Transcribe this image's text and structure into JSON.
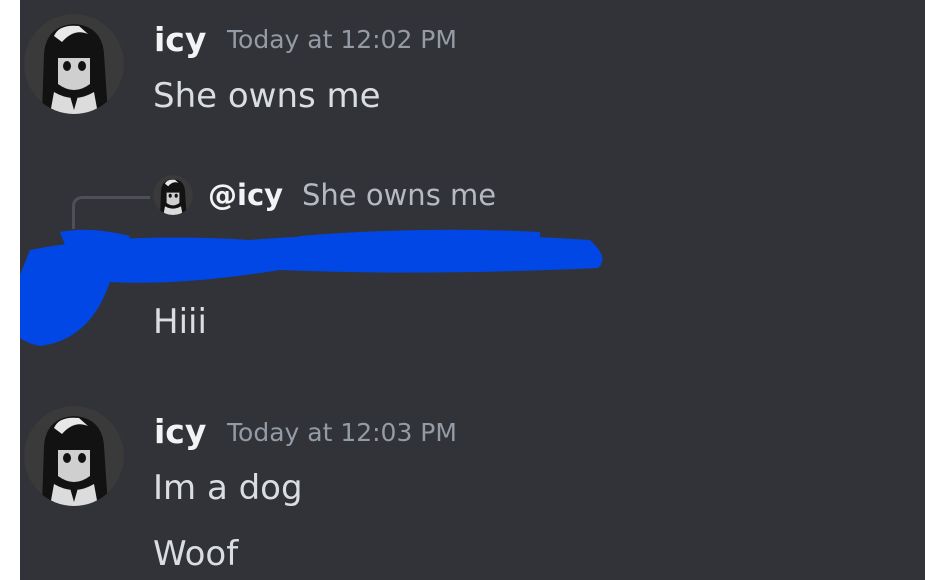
{
  "messages": [
    {
      "author": "icy",
      "timestamp": "Today at 12:02 PM",
      "lines": [
        "She owns me"
      ]
    },
    {
      "reply": {
        "mention": "@icy",
        "content": "She owns me"
      },
      "author": "",
      "timestamp": "",
      "lines": [
        "Hiii"
      ],
      "redacted": true
    },
    {
      "author": "icy",
      "timestamp": "Today at 12:03 PM",
      "lines": [
        "Im a dog",
        "Woof"
      ]
    }
  ],
  "colors": {
    "background": "#313338",
    "author": "#f2f3f5",
    "timestamp": "#949ba4",
    "text": "#dbdee1",
    "redaction": "#0047e6"
  },
  "icons": {
    "avatar": "anime-girl-avatar-icon"
  }
}
